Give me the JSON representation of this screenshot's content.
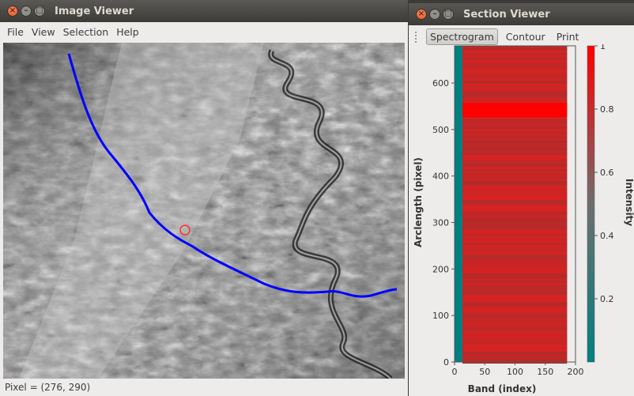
{
  "image_viewer": {
    "title": "Image Viewer",
    "menu": [
      "File",
      "View",
      "Selection",
      "Help"
    ],
    "status": "Pixel = (276, 290)"
  },
  "section_viewer": {
    "title": "Section Viewer",
    "tabs": [
      "Spectrogram",
      "Contour",
      "Print"
    ],
    "active_tab": "Spectrogram"
  },
  "chart_data": {
    "type": "heatmap",
    "xlabel": "Band (index)",
    "ylabel": "Arclength (pixel)",
    "colorbar_label": "Intensity",
    "xlim": [
      0,
      200
    ],
    "ylim": [
      0,
      680
    ],
    "x_ticks": [
      0,
      50,
      100,
      150,
      200
    ],
    "y_ticks": [
      0,
      100,
      200,
      300,
      400,
      500,
      600
    ],
    "colorbar_ticks": [
      0.2,
      0.4,
      0.6,
      0.8,
      1
    ],
    "colorbar_range": [
      0,
      1
    ],
    "data_extent_bands": [
      0,
      186
    ],
    "high_intensity_arclength_range": [
      530,
      560
    ]
  },
  "colors": {
    "heat_high": "#ff0000",
    "heat_mid": "#7a4a4a",
    "heat_low": "#008080",
    "path": "#0000ff",
    "marker": "#ff3030"
  }
}
